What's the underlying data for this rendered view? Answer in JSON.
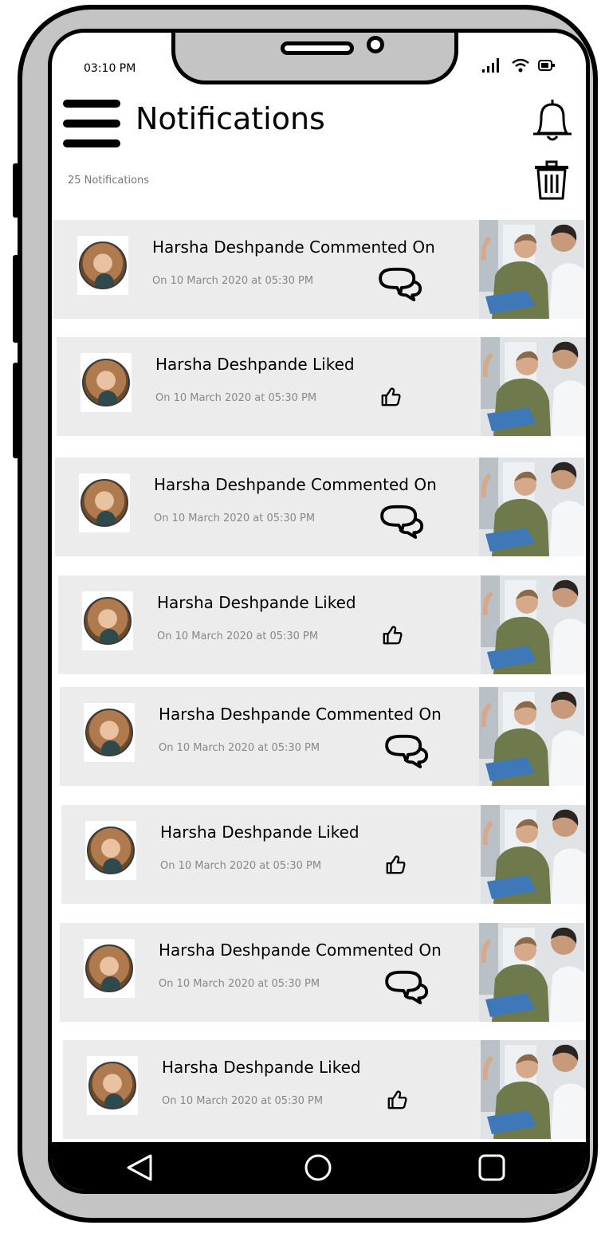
{
  "status": {
    "time": "03:10 PM"
  },
  "header": {
    "title": "Notifications",
    "count_label": "25 Notifications"
  },
  "colors": {
    "card_bg": "#ececec",
    "frame": "#c4c4c4",
    "muted_text": "#888888"
  },
  "notifications": [
    {
      "title": "Harsha  Deshpande Commented On",
      "time": "On 10 March 2020 at 05:30 PM",
      "icon": "comment-icon"
    },
    {
      "title": "Harsha  Deshpande Liked",
      "time": "On 10 March 2020 at 05:30 PM",
      "icon": "thumbs-up-icon"
    },
    {
      "title": "Harsha  Deshpande Commented On",
      "time": "On 10 March 2020 at 05:30 PM",
      "icon": "comment-icon"
    },
    {
      "title": "Harsha  Deshpande Liked",
      "time": "On 10 March 2020 at 05:30 PM",
      "icon": "thumbs-up-icon"
    },
    {
      "title": "Harsha  Deshpande Commented On",
      "time": "On 10 March 2020 at 05:30 PM",
      "icon": "comment-icon"
    },
    {
      "title": "Harsha  Deshpande Liked",
      "time": "On 10 March 2020 at 05:30 PM",
      "icon": "thumbs-up-icon"
    },
    {
      "title": "Harsha  Deshpande Commented On",
      "time": "On 10 March 2020 at 05:30 PM",
      "icon": "comment-icon"
    },
    {
      "title": "Harsha  Deshpande Liked",
      "time": "On 10 March 2020 at 05:30 PM",
      "icon": "thumbs-up-icon"
    }
  ],
  "nav": {
    "back_icon": "back-triangle-icon",
    "home_icon": "home-circle-icon",
    "recents_icon": "recents-square-icon"
  }
}
